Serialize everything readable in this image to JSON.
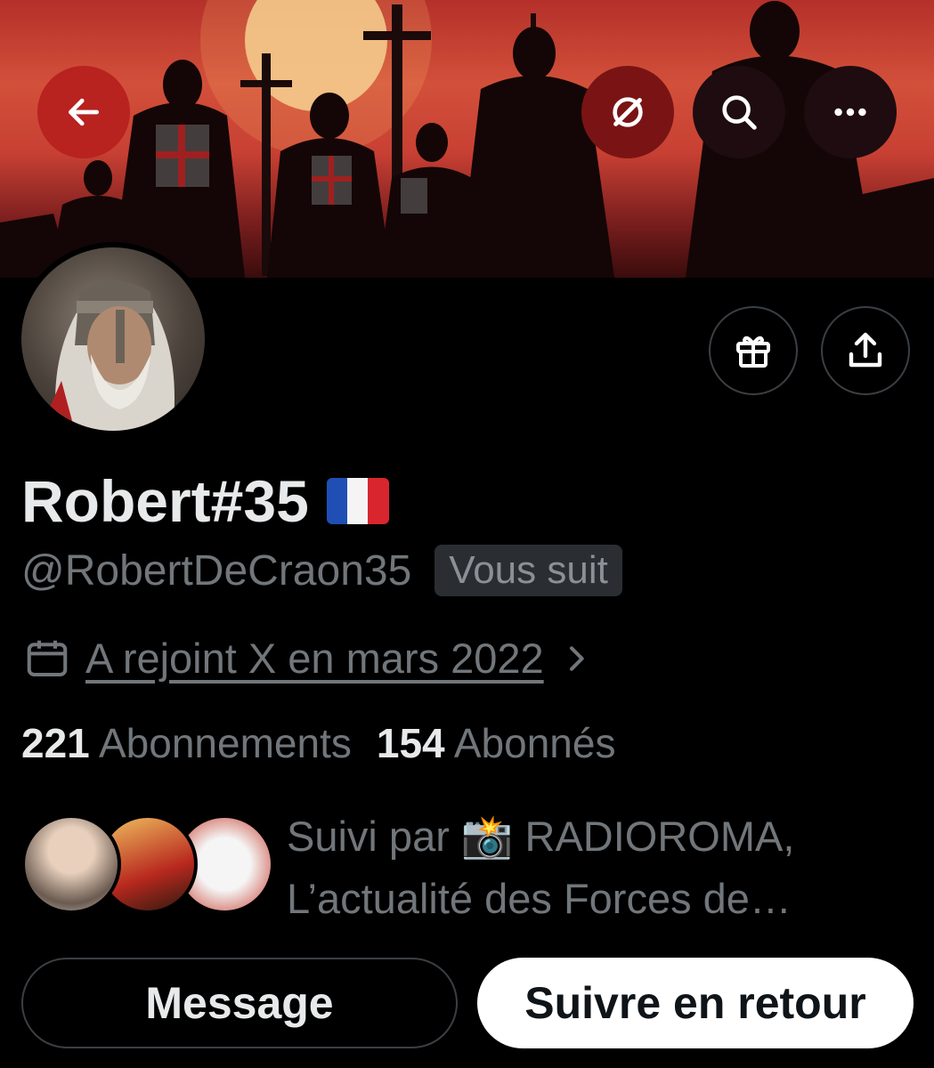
{
  "profile": {
    "display_name": "Robert#35",
    "handle": "@RobertDeCraon35",
    "follows_you_badge": "Vous suit",
    "joined": "A rejoint X en mars 2022",
    "following_count": "221",
    "following_label": "Abonnements",
    "followers_count": "154",
    "followers_label": "Abonnés",
    "followed_by_line1": "Suivi par 📸 RADIOROMA,",
    "followed_by_line2": "L’actualité des Forces de…"
  },
  "actions": {
    "message_label": "Message",
    "follow_back_label": "Suivre en retour"
  },
  "icons": {
    "back": "back-arrow-icon",
    "grok": "grok-icon",
    "search": "search-icon",
    "more": "more-icon",
    "gift": "gift-icon",
    "share": "share-icon",
    "calendar": "calendar-icon",
    "chevron": "chevron-right-icon"
  },
  "colors": {
    "background": "#000000",
    "primary_text": "#e7e9ea",
    "secondary_text": "#71767b",
    "follow_button_bg": "#ffffff"
  }
}
